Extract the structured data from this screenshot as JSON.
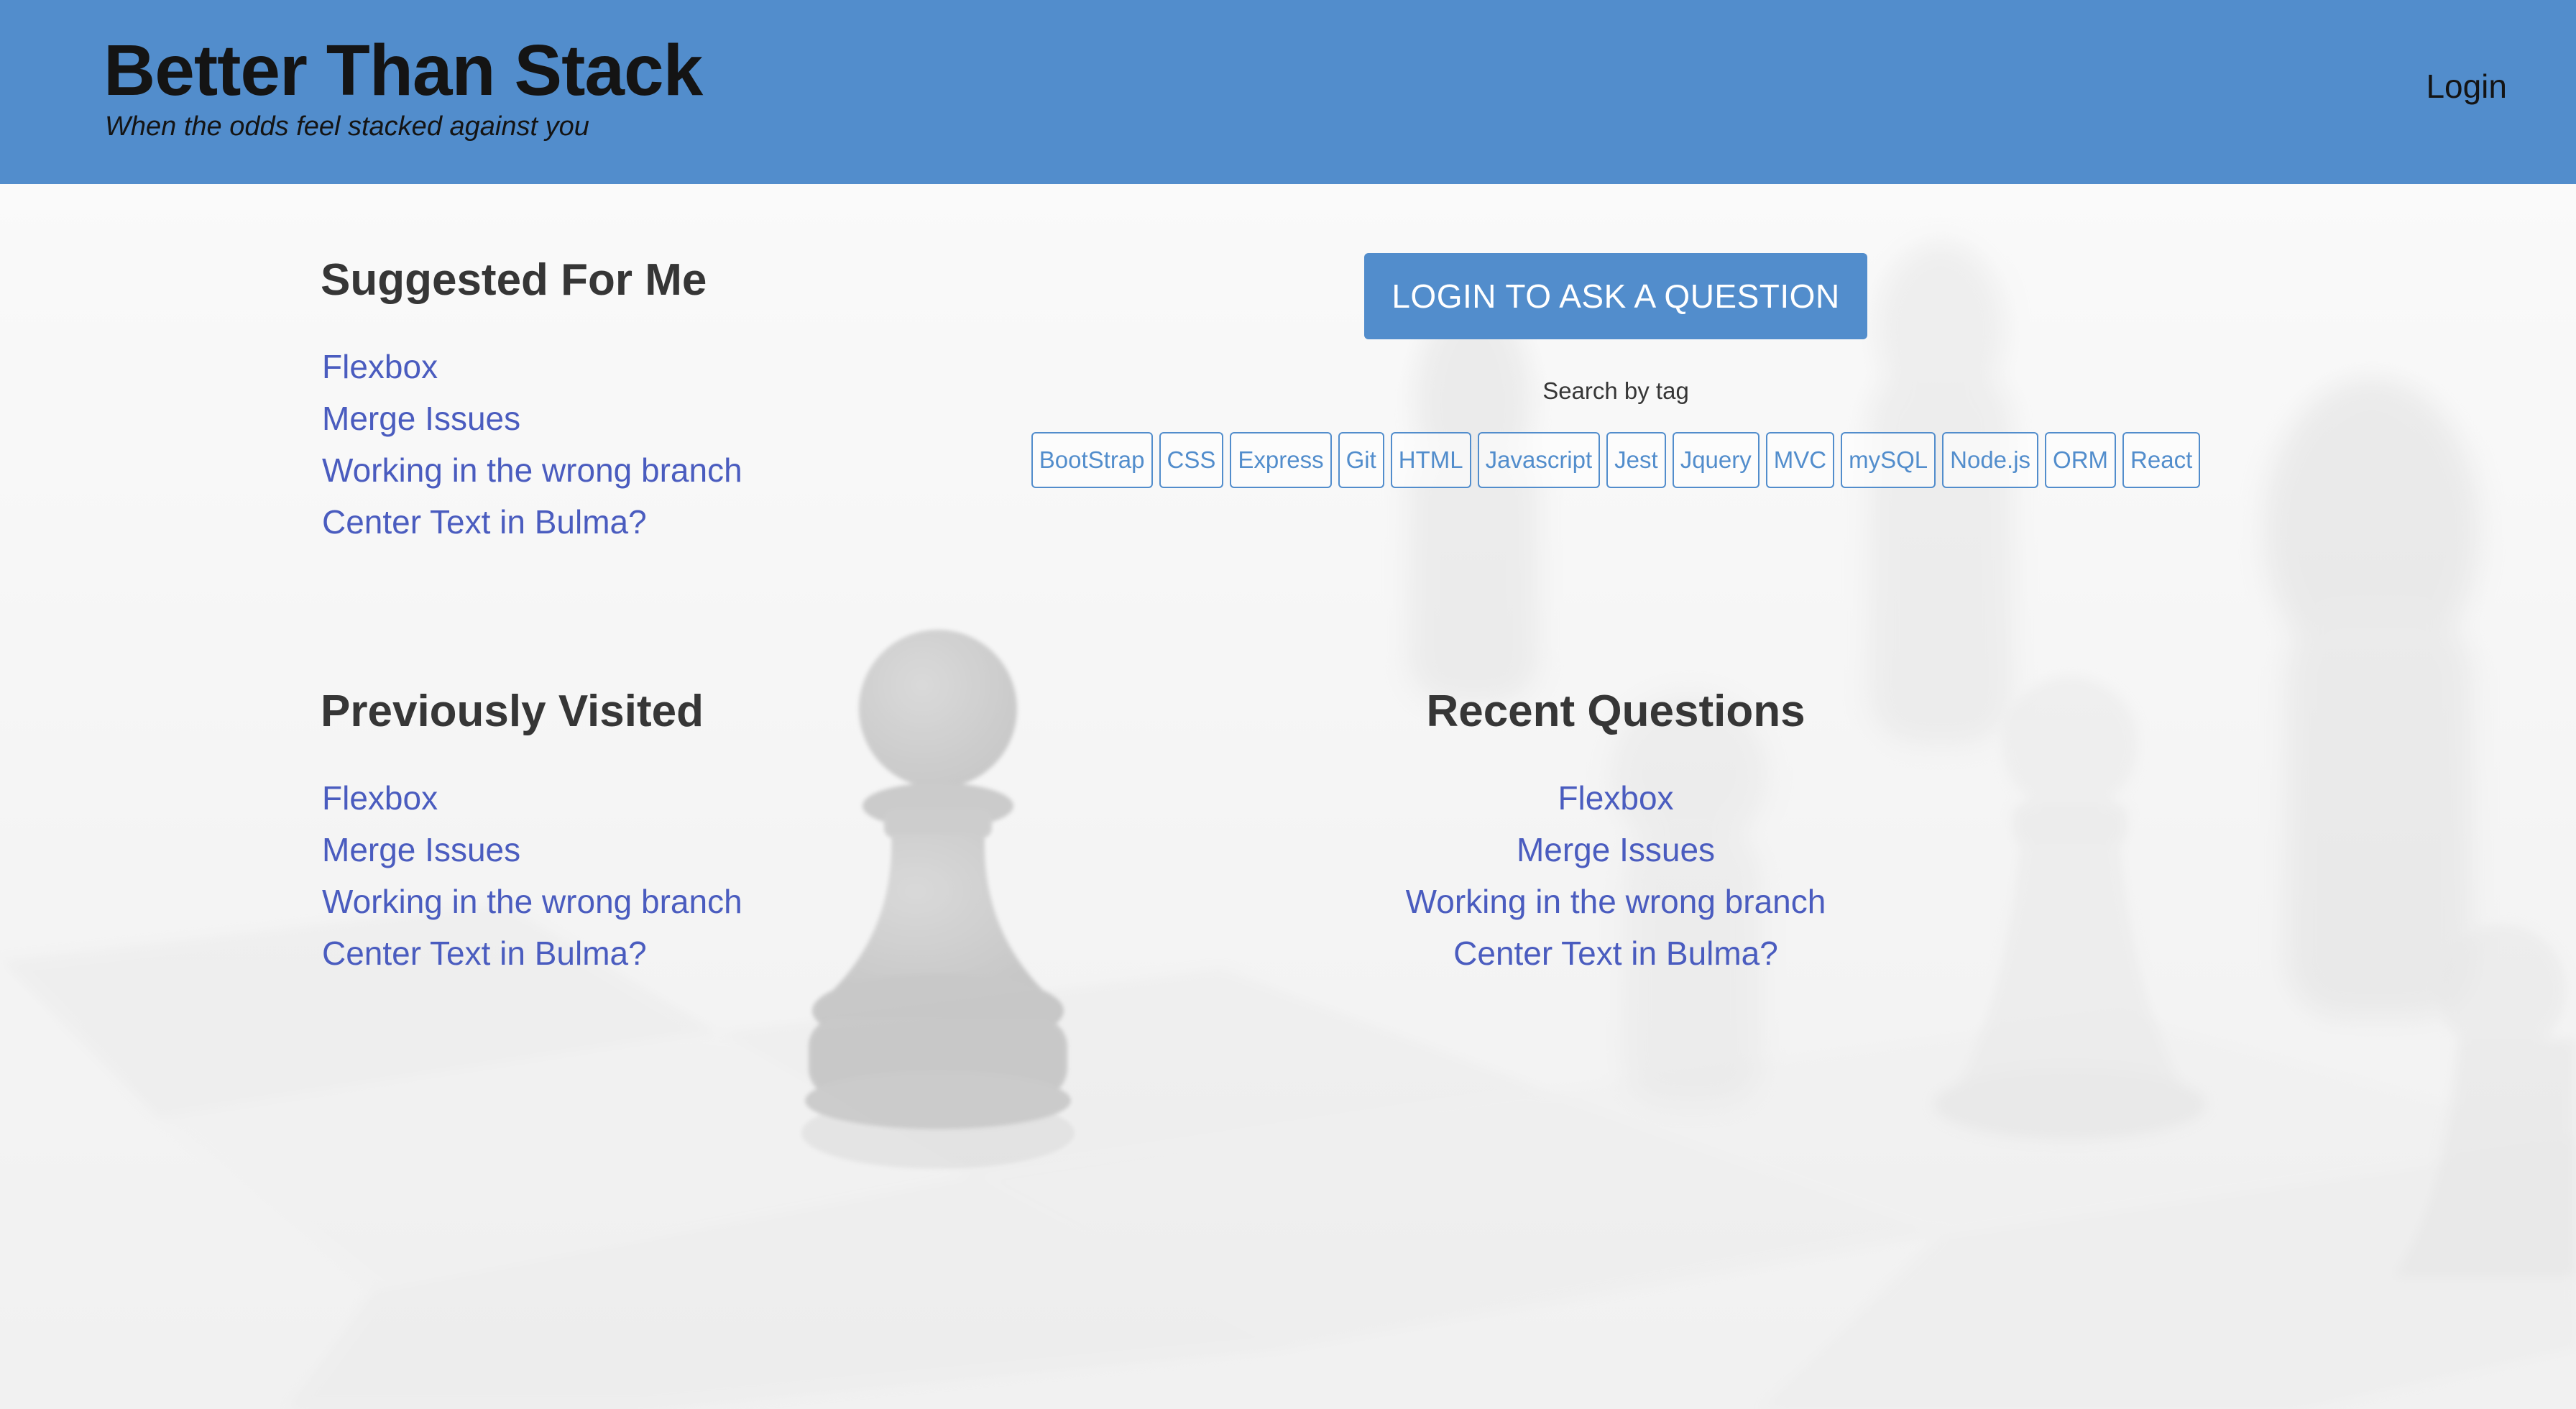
{
  "header": {
    "title": "Better Than Stack",
    "tagline": "When the odds feel stacked against you",
    "login_label": "Login",
    "background_color": "#528dcc"
  },
  "suggested": {
    "heading": "Suggested For Me",
    "links": [
      "Flexbox",
      "Merge Issues",
      "Working in the wrong branch",
      "Center Text in Bulma?"
    ]
  },
  "ask": {
    "button_label": "LOGIN TO ASK A QUESTION",
    "search_label": "Search by tag",
    "tags": [
      "BootStrap",
      "CSS",
      "Express",
      "Git",
      "HTML",
      "Javascript",
      "Jest",
      "Jquery",
      "MVC",
      "mySQL",
      "Node.js",
      "ORM",
      "React"
    ]
  },
  "previously_visited": {
    "heading": "Previously Visited",
    "links": [
      "Flexbox",
      "Merge Issues",
      "Working in the wrong branch",
      "Center Text in Bulma?"
    ]
  },
  "recent_questions": {
    "heading": "Recent Questions",
    "links": [
      "Flexbox",
      "Merge Issues",
      "Working in the wrong branch",
      "Center Text in Bulma?"
    ]
  },
  "colors": {
    "accent": "#528dcc",
    "link": "#4a5cbf",
    "heading": "#363636"
  },
  "background": {
    "image_subject": "chess-pieces-background-image"
  }
}
